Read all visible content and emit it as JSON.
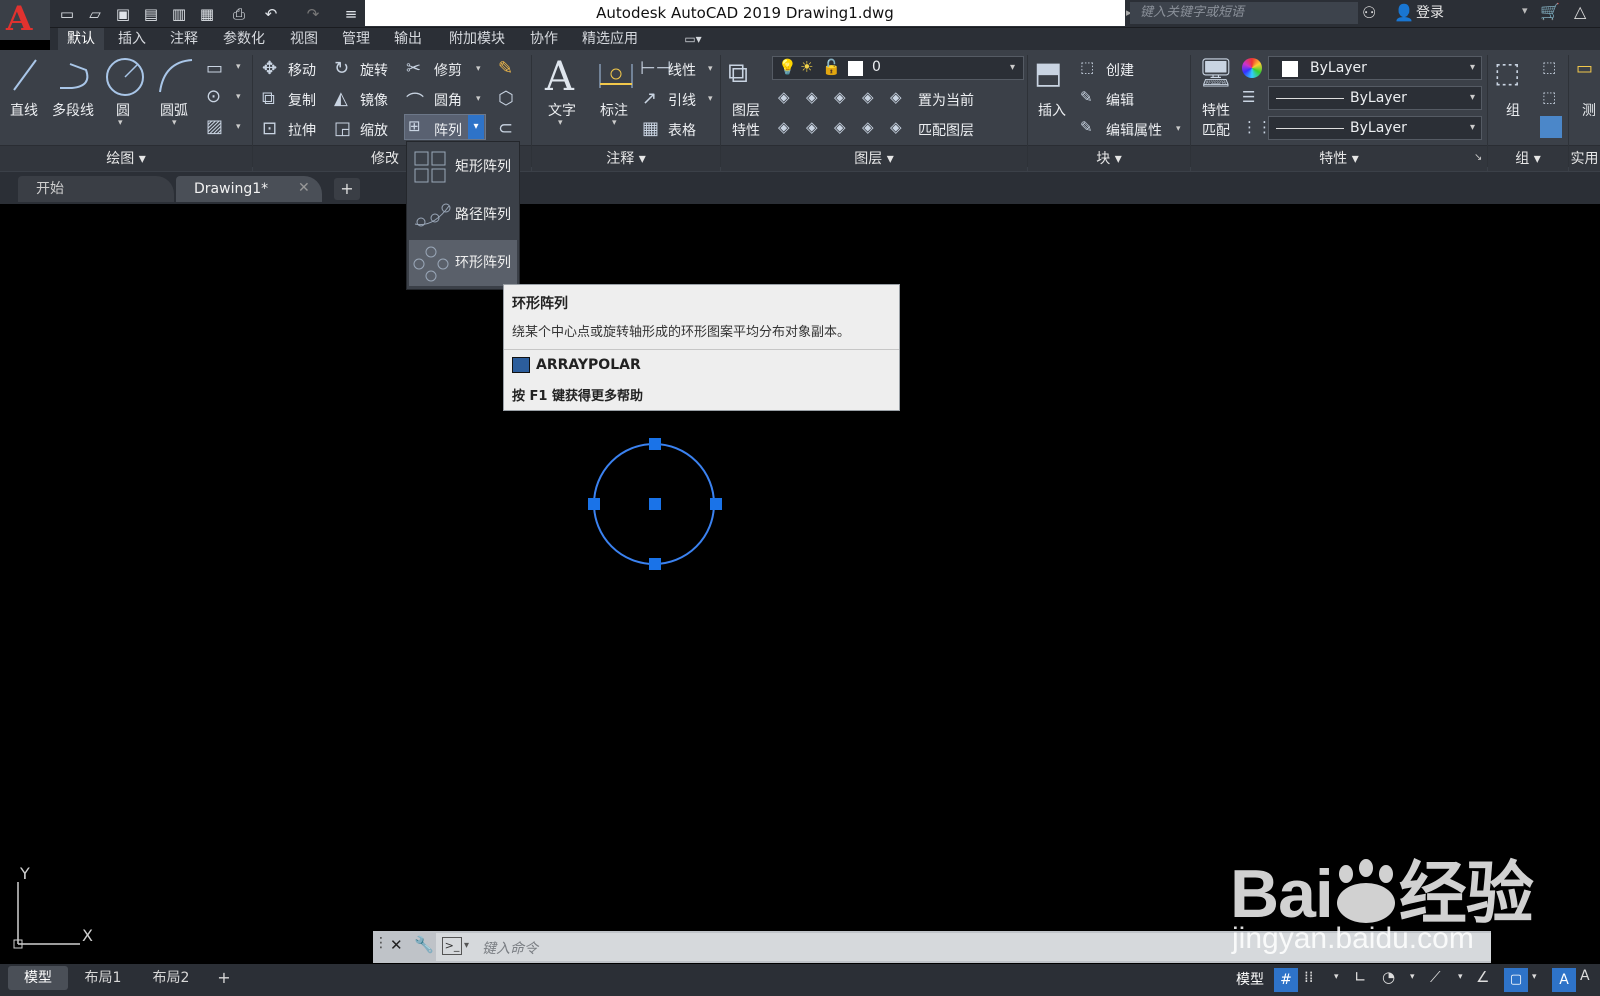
{
  "app": {
    "logo": "A",
    "title": "Autodesk AutoCAD 2019    Drawing1.dwg",
    "search_placeholder": "键入关键字或短语",
    "login": "登录"
  },
  "menu_tabs": [
    "默认",
    "插入",
    "注释",
    "参数化",
    "视图",
    "管理",
    "输出",
    "附加模块",
    "协作",
    "精选应用"
  ],
  "ribbon": {
    "draw": {
      "line": "直线",
      "polyline": "多段线",
      "circle": "圆",
      "arc": "圆弧",
      "panel": "绘图"
    },
    "modify": {
      "move": "移动",
      "rotate": "旋转",
      "trim": "修剪",
      "copy": "复制",
      "mirror": "镜像",
      "fillet": "圆角",
      "stretch": "拉伸",
      "scale": "缩放",
      "array": "阵列",
      "panel": "修改"
    },
    "annotation": {
      "text": "文字",
      "dimension": "标注",
      "linear": "线性",
      "leader": "引线",
      "table": "表格",
      "panel": "注释"
    },
    "layers": {
      "layer_props_1": "图层",
      "layer_props_2": "特性",
      "current_layer": "0",
      "set_current": "置为当前",
      "match_layer": "匹配图层",
      "panel": "图层"
    },
    "block": {
      "insert": "插入",
      "create": "创建",
      "edit": "编辑",
      "edit_attr": "编辑属性",
      "panel": "块"
    },
    "properties": {
      "match_1": "特性",
      "match_2": "匹配",
      "color": "ByLayer",
      "linetype": "ByLayer",
      "lineweight": "ByLayer",
      "panel": "特性"
    },
    "groups": {
      "group": "组",
      "panel": "组"
    },
    "utilities": {
      "measure": "测",
      "panel": "实用"
    }
  },
  "doc_tabs": [
    "开始",
    "Drawing1*"
  ],
  "array_menu": [
    "矩形阵列",
    "路径阵列",
    "环形阵列"
  ],
  "tooltip": {
    "title": "环形阵列",
    "desc": "绕某个中心点或旋转轴形成的环形图案平均分布对象副本。",
    "command": "ARRAYPOLAR",
    "help": "按 F1 键获得更多帮助"
  },
  "ucs": {
    "y": "Y",
    "x": "X"
  },
  "command": {
    "placeholder": "键入命令"
  },
  "layout_tabs": [
    "模型",
    "布局1",
    "布局2"
  ],
  "status": {
    "model": "模型"
  },
  "watermark": {
    "brand": "Bai",
    "brand2": "经验",
    "url": "jingyan.baidu.com"
  },
  "colors": {
    "accent": "#1e7ae6",
    "circle": "#2f7ff0",
    "grip": "#1a73e8"
  }
}
